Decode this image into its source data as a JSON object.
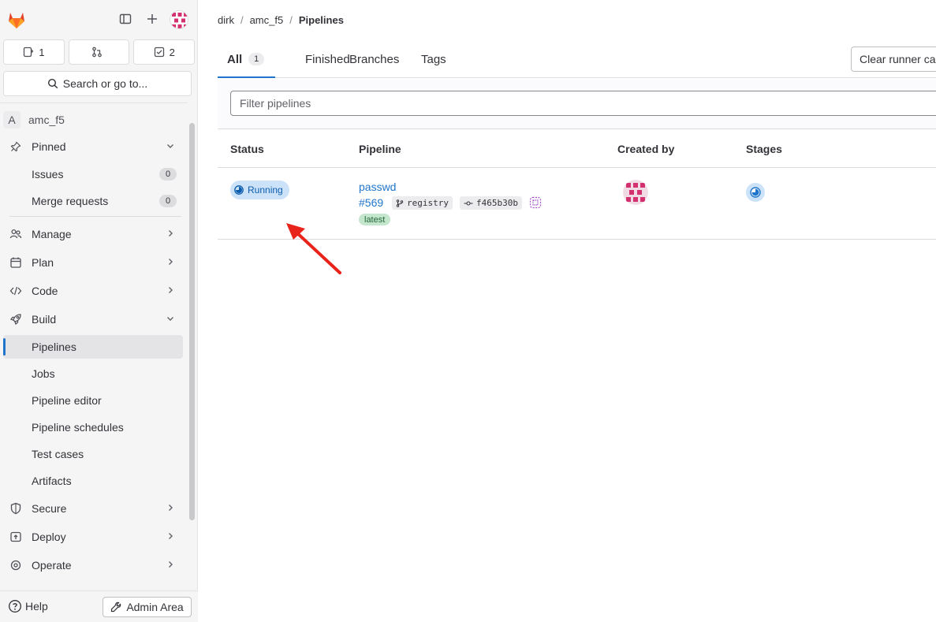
{
  "sidebar": {
    "counters": [
      {
        "icon": "issues-icon",
        "value": "1"
      },
      {
        "icon": "merge-request-icon",
        "value": ""
      },
      {
        "icon": "todo-icon",
        "value": "2"
      }
    ],
    "search_label": "Search or go to...",
    "project_initial": "A",
    "project_name": "amc_f5",
    "pinned": {
      "label": "Pinned",
      "items": [
        {
          "label": "Issues",
          "count": "0"
        },
        {
          "label": "Merge requests",
          "count": "0"
        }
      ]
    },
    "sections": {
      "manage": "Manage",
      "plan": "Plan",
      "code": "Code",
      "build": "Build",
      "secure": "Secure",
      "deploy": "Deploy",
      "operate": "Operate"
    },
    "build_items": [
      "Pipelines",
      "Jobs",
      "Pipeline editor",
      "Pipeline schedules",
      "Test cases",
      "Artifacts"
    ],
    "help_label": "Help",
    "admin_label": "Admin Area"
  },
  "breadcrumb": [
    "dirk",
    "amc_f5",
    "Pipelines"
  ],
  "tabs": [
    {
      "label": "All",
      "count": "1"
    },
    {
      "label": "Finished"
    },
    {
      "label": "Branches"
    },
    {
      "label": "Tags"
    }
  ],
  "clear_runner_label": "Clear runner caches",
  "filter_placeholder": "Filter pipelines",
  "table": {
    "headers": [
      "Status",
      "Pipeline",
      "Created by",
      "Stages"
    ],
    "rows": [
      {
        "status": "Running",
        "name": "passwd",
        "id": "#569",
        "branch": "registry",
        "commit": "f465b30b",
        "tag": "latest"
      }
    ]
  },
  "colors": {
    "accent": "#1f75cb",
    "running_bg": "#cbe2f9",
    "running_fg": "#0b5cad",
    "latest_bg": "#c3e6cd",
    "annotation_arrow": "#e8231a"
  }
}
